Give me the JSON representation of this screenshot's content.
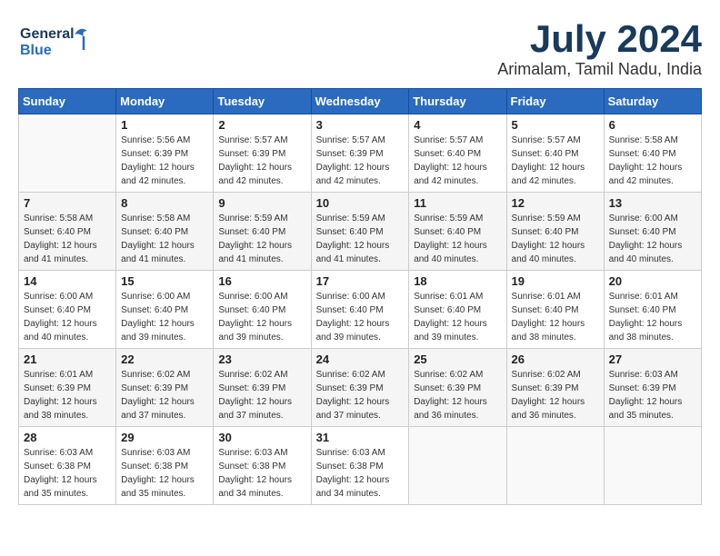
{
  "header": {
    "logo_general": "General",
    "logo_blue": "Blue",
    "month_title": "July 2024",
    "location": "Arimalam, Tamil Nadu, India"
  },
  "days_of_week": [
    "Sunday",
    "Monday",
    "Tuesday",
    "Wednesday",
    "Thursday",
    "Friday",
    "Saturday"
  ],
  "weeks": [
    [
      {
        "day": "",
        "info": ""
      },
      {
        "day": "1",
        "info": "Sunrise: 5:56 AM\nSunset: 6:39 PM\nDaylight: 12 hours\nand 42 minutes."
      },
      {
        "day": "2",
        "info": "Sunrise: 5:57 AM\nSunset: 6:39 PM\nDaylight: 12 hours\nand 42 minutes."
      },
      {
        "day": "3",
        "info": "Sunrise: 5:57 AM\nSunset: 6:39 PM\nDaylight: 12 hours\nand 42 minutes."
      },
      {
        "day": "4",
        "info": "Sunrise: 5:57 AM\nSunset: 6:40 PM\nDaylight: 12 hours\nand 42 minutes."
      },
      {
        "day": "5",
        "info": "Sunrise: 5:57 AM\nSunset: 6:40 PM\nDaylight: 12 hours\nand 42 minutes."
      },
      {
        "day": "6",
        "info": "Sunrise: 5:58 AM\nSunset: 6:40 PM\nDaylight: 12 hours\nand 42 minutes."
      }
    ],
    [
      {
        "day": "7",
        "info": "Sunrise: 5:58 AM\nSunset: 6:40 PM\nDaylight: 12 hours\nand 41 minutes."
      },
      {
        "day": "8",
        "info": "Sunrise: 5:58 AM\nSunset: 6:40 PM\nDaylight: 12 hours\nand 41 minutes."
      },
      {
        "day": "9",
        "info": "Sunrise: 5:59 AM\nSunset: 6:40 PM\nDaylight: 12 hours\nand 41 minutes."
      },
      {
        "day": "10",
        "info": "Sunrise: 5:59 AM\nSunset: 6:40 PM\nDaylight: 12 hours\nand 41 minutes."
      },
      {
        "day": "11",
        "info": "Sunrise: 5:59 AM\nSunset: 6:40 PM\nDaylight: 12 hours\nand 40 minutes."
      },
      {
        "day": "12",
        "info": "Sunrise: 5:59 AM\nSunset: 6:40 PM\nDaylight: 12 hours\nand 40 minutes."
      },
      {
        "day": "13",
        "info": "Sunrise: 6:00 AM\nSunset: 6:40 PM\nDaylight: 12 hours\nand 40 minutes."
      }
    ],
    [
      {
        "day": "14",
        "info": "Sunrise: 6:00 AM\nSunset: 6:40 PM\nDaylight: 12 hours\nand 40 minutes."
      },
      {
        "day": "15",
        "info": "Sunrise: 6:00 AM\nSunset: 6:40 PM\nDaylight: 12 hours\nand 39 minutes."
      },
      {
        "day": "16",
        "info": "Sunrise: 6:00 AM\nSunset: 6:40 PM\nDaylight: 12 hours\nand 39 minutes."
      },
      {
        "day": "17",
        "info": "Sunrise: 6:00 AM\nSunset: 6:40 PM\nDaylight: 12 hours\nand 39 minutes."
      },
      {
        "day": "18",
        "info": "Sunrise: 6:01 AM\nSunset: 6:40 PM\nDaylight: 12 hours\nand 39 minutes."
      },
      {
        "day": "19",
        "info": "Sunrise: 6:01 AM\nSunset: 6:40 PM\nDaylight: 12 hours\nand 38 minutes."
      },
      {
        "day": "20",
        "info": "Sunrise: 6:01 AM\nSunset: 6:40 PM\nDaylight: 12 hours\nand 38 minutes."
      }
    ],
    [
      {
        "day": "21",
        "info": "Sunrise: 6:01 AM\nSunset: 6:39 PM\nDaylight: 12 hours\nand 38 minutes."
      },
      {
        "day": "22",
        "info": "Sunrise: 6:02 AM\nSunset: 6:39 PM\nDaylight: 12 hours\nand 37 minutes."
      },
      {
        "day": "23",
        "info": "Sunrise: 6:02 AM\nSunset: 6:39 PM\nDaylight: 12 hours\nand 37 minutes."
      },
      {
        "day": "24",
        "info": "Sunrise: 6:02 AM\nSunset: 6:39 PM\nDaylight: 12 hours\nand 37 minutes."
      },
      {
        "day": "25",
        "info": "Sunrise: 6:02 AM\nSunset: 6:39 PM\nDaylight: 12 hours\nand 36 minutes."
      },
      {
        "day": "26",
        "info": "Sunrise: 6:02 AM\nSunset: 6:39 PM\nDaylight: 12 hours\nand 36 minutes."
      },
      {
        "day": "27",
        "info": "Sunrise: 6:03 AM\nSunset: 6:39 PM\nDaylight: 12 hours\nand 35 minutes."
      }
    ],
    [
      {
        "day": "28",
        "info": "Sunrise: 6:03 AM\nSunset: 6:38 PM\nDaylight: 12 hours\nand 35 minutes."
      },
      {
        "day": "29",
        "info": "Sunrise: 6:03 AM\nSunset: 6:38 PM\nDaylight: 12 hours\nand 35 minutes."
      },
      {
        "day": "30",
        "info": "Sunrise: 6:03 AM\nSunset: 6:38 PM\nDaylight: 12 hours\nand 34 minutes."
      },
      {
        "day": "31",
        "info": "Sunrise: 6:03 AM\nSunset: 6:38 PM\nDaylight: 12 hours\nand 34 minutes."
      },
      {
        "day": "",
        "info": ""
      },
      {
        "day": "",
        "info": ""
      },
      {
        "day": "",
        "info": ""
      }
    ]
  ]
}
